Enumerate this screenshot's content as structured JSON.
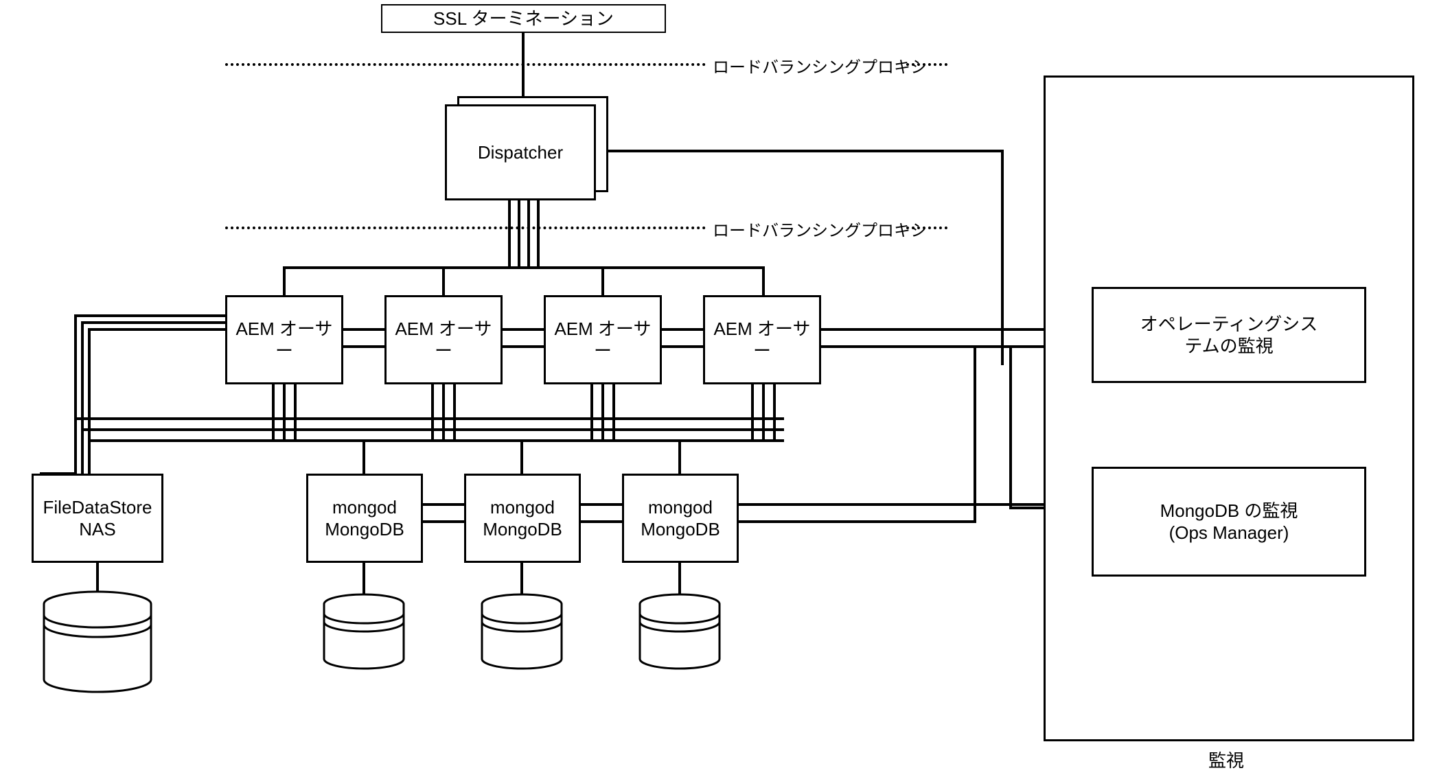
{
  "ssl": "SSL ターミネーション",
  "dispatcher": "Dispatcher",
  "loadBalLabel1": "ロードバランシングプロキシ",
  "loadBalLabel2": "ロードバランシングプロキシ",
  "aem": {
    "a": "AEM オーサー",
    "b": "AEM オーサー",
    "c": "AEM オーサー",
    "d": "AEM オーサー"
  },
  "fds": {
    "l1": "FileDataStore",
    "l2": "NAS"
  },
  "mongo": {
    "l1": "mongod",
    "l2": "MongoDB"
  },
  "osmon": {
    "l1": "オペレーティングシス",
    "l2": "テムの監視"
  },
  "dbmon": {
    "l1": "MongoDB の監視",
    "l2": "(Ops Manager)"
  },
  "monitorCaption": "監視"
}
